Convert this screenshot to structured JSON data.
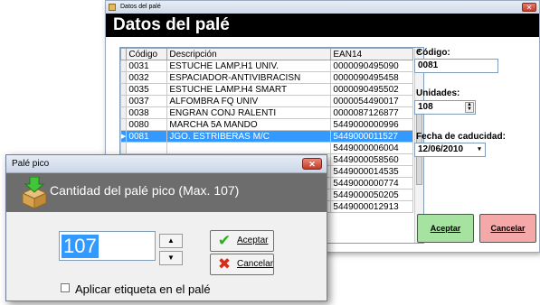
{
  "back_window": {
    "title": "Datos del palé",
    "header": "Datos del palé",
    "close_label": "✕",
    "table": {
      "columns": [
        "Código",
        "Descripción",
        "EAN14"
      ],
      "rows": [
        [
          "0031",
          "ESTUCHE LAMP.H1 UNIV.",
          "0000090495090"
        ],
        [
          "0032",
          "ESPACIADOR-ANTIVIBRACISN",
          "0000090495458"
        ],
        [
          "0035",
          "ESTUCHE LAMP.H4 SMART",
          "0000090495502"
        ],
        [
          "0037",
          "ALFOMBRA FQ UNIV",
          "0000054490017"
        ],
        [
          "0038",
          "ENGRAN CONJ RALENTI",
          "0000087126877"
        ],
        [
          "0080",
          "MARCHA 5A MANDO",
          "5449000000996"
        ],
        [
          "0081",
          "JGO. ESTRIBERAS M/C",
          "5449000011527"
        ],
        [
          "",
          "",
          "5449000006004"
        ],
        [
          "",
          "",
          "5449000058560"
        ],
        [
          "",
          "",
          "5449000014535"
        ],
        [
          "",
          "",
          "5449000000774"
        ],
        [
          "",
          "",
          "5449000050205"
        ],
        [
          "",
          "",
          "5449000012913"
        ]
      ],
      "selected_row": 6
    },
    "codigo": {
      "label": "Código:",
      "value": "0081"
    },
    "unidades": {
      "label": "Unidades:",
      "value": "108"
    },
    "fecha": {
      "label": "Fecha de caducidad:",
      "value": "12/06/2010"
    },
    "accept_button": "Aceptar",
    "cancel_button": "Cancelar",
    "colors": {
      "accept_bg": "#a6e3a1",
      "cancel_bg": "#f4a8a8",
      "selection": "#3399ff"
    }
  },
  "dialog": {
    "title": "Palé pico",
    "close_label": "✕",
    "heading": "Cantidad del palé pico  (Max. 107)",
    "quantity": "107",
    "up_label": "▲",
    "down_label": "▼",
    "accept_label": "Aceptar",
    "cancel_label": "Cancelar",
    "checkbox_label": "Aplicar etiqueta en el palé",
    "checkbox_checked": false,
    "accept_icon": "green-checkmark-icon",
    "cancel_icon": "red-x-icon",
    "header_icon": "box-download-icon"
  }
}
